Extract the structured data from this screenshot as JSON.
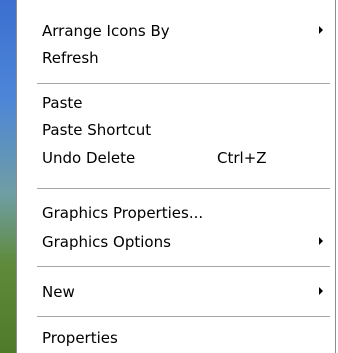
{
  "menu": {
    "items": {
      "arrange_icons_by": {
        "label": "Arrange Icons By",
        "has_submenu": true
      },
      "refresh": {
        "label": "Refresh"
      },
      "paste": {
        "label": "Paste"
      },
      "paste_shortcut": {
        "label": "Paste Shortcut"
      },
      "undo_delete": {
        "label": "Undo Delete",
        "shortcut": "Ctrl+Z"
      },
      "graphics_properties": {
        "label": "Graphics Properties..."
      },
      "graphics_options": {
        "label": "Graphics Options",
        "has_submenu": true
      },
      "new": {
        "label": "New",
        "has_submenu": true
      },
      "properties": {
        "label": "Properties"
      }
    }
  },
  "colors": {
    "menu_background": "#ffffff",
    "text": "#000000",
    "separator": "#a6a6a6",
    "border": "#8c8c8c"
  },
  "icons": {
    "submenu_indicator": "chevron-right-icon"
  }
}
